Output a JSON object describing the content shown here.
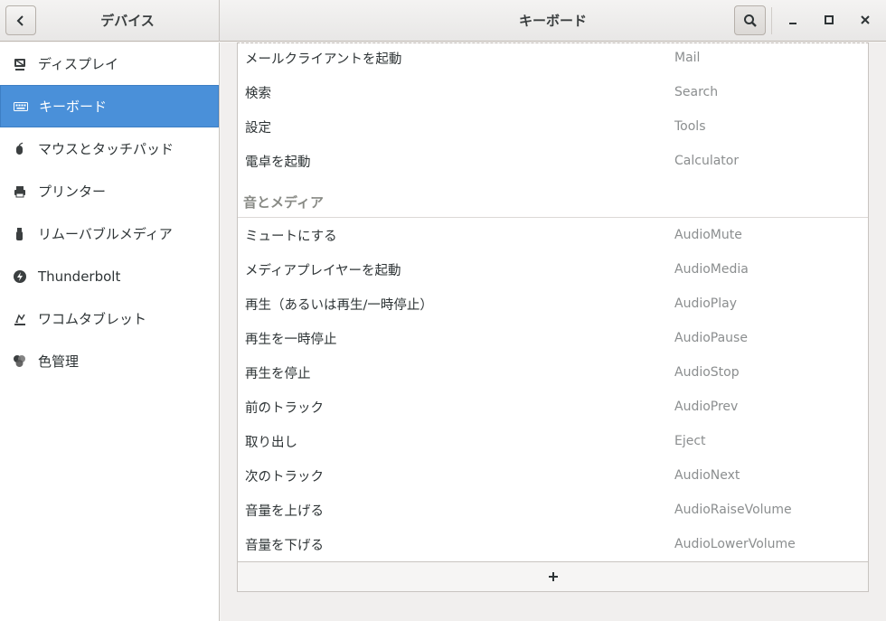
{
  "header": {
    "left_title": "デバイス",
    "main_title": "キーボード"
  },
  "sidebar": {
    "items": [
      {
        "label": "ディスプレイ",
        "icon": "display-icon"
      },
      {
        "label": "キーボード",
        "icon": "keyboard-icon",
        "selected": true
      },
      {
        "label": "マウスとタッチパッド",
        "icon": "mouse-icon"
      },
      {
        "label": "プリンター",
        "icon": "printer-icon"
      },
      {
        "label": "リムーバブルメディア",
        "icon": "usb-drive-icon"
      },
      {
        "label": "Thunderbolt",
        "icon": "thunderbolt-icon"
      },
      {
        "label": "ワコムタブレット",
        "icon": "tablet-icon"
      },
      {
        "label": "色管理",
        "icon": "color-circles-icon"
      }
    ]
  },
  "shortcuts_top": [
    {
      "name": "メールクライアントを起動",
      "key": "Mail"
    },
    {
      "name": "検索",
      "key": "Search"
    },
    {
      "name": "設定",
      "key": "Tools"
    },
    {
      "name": "電卓を起動",
      "key": "Calculator"
    }
  ],
  "section_title": "音とメディア",
  "shortcuts_media": [
    {
      "name": "ミュートにする",
      "key": "AudioMute"
    },
    {
      "name": "メディアプレイヤーを起動",
      "key": "AudioMedia"
    },
    {
      "name": "再生（あるいは再生/一時停止）",
      "key": "AudioPlay"
    },
    {
      "name": "再生を一時停止",
      "key": "AudioPause"
    },
    {
      "name": "再生を停止",
      "key": "AudioStop"
    },
    {
      "name": "前のトラック",
      "key": "AudioPrev"
    },
    {
      "name": "取り出し",
      "key": "Eject"
    },
    {
      "name": "次のトラック",
      "key": "AudioNext"
    },
    {
      "name": "音量を上げる",
      "key": "AudioRaiseVolume"
    },
    {
      "name": "音量を下げる",
      "key": "AudioLowerVolume"
    }
  ],
  "colors": {
    "accent": "#4a90d9"
  }
}
